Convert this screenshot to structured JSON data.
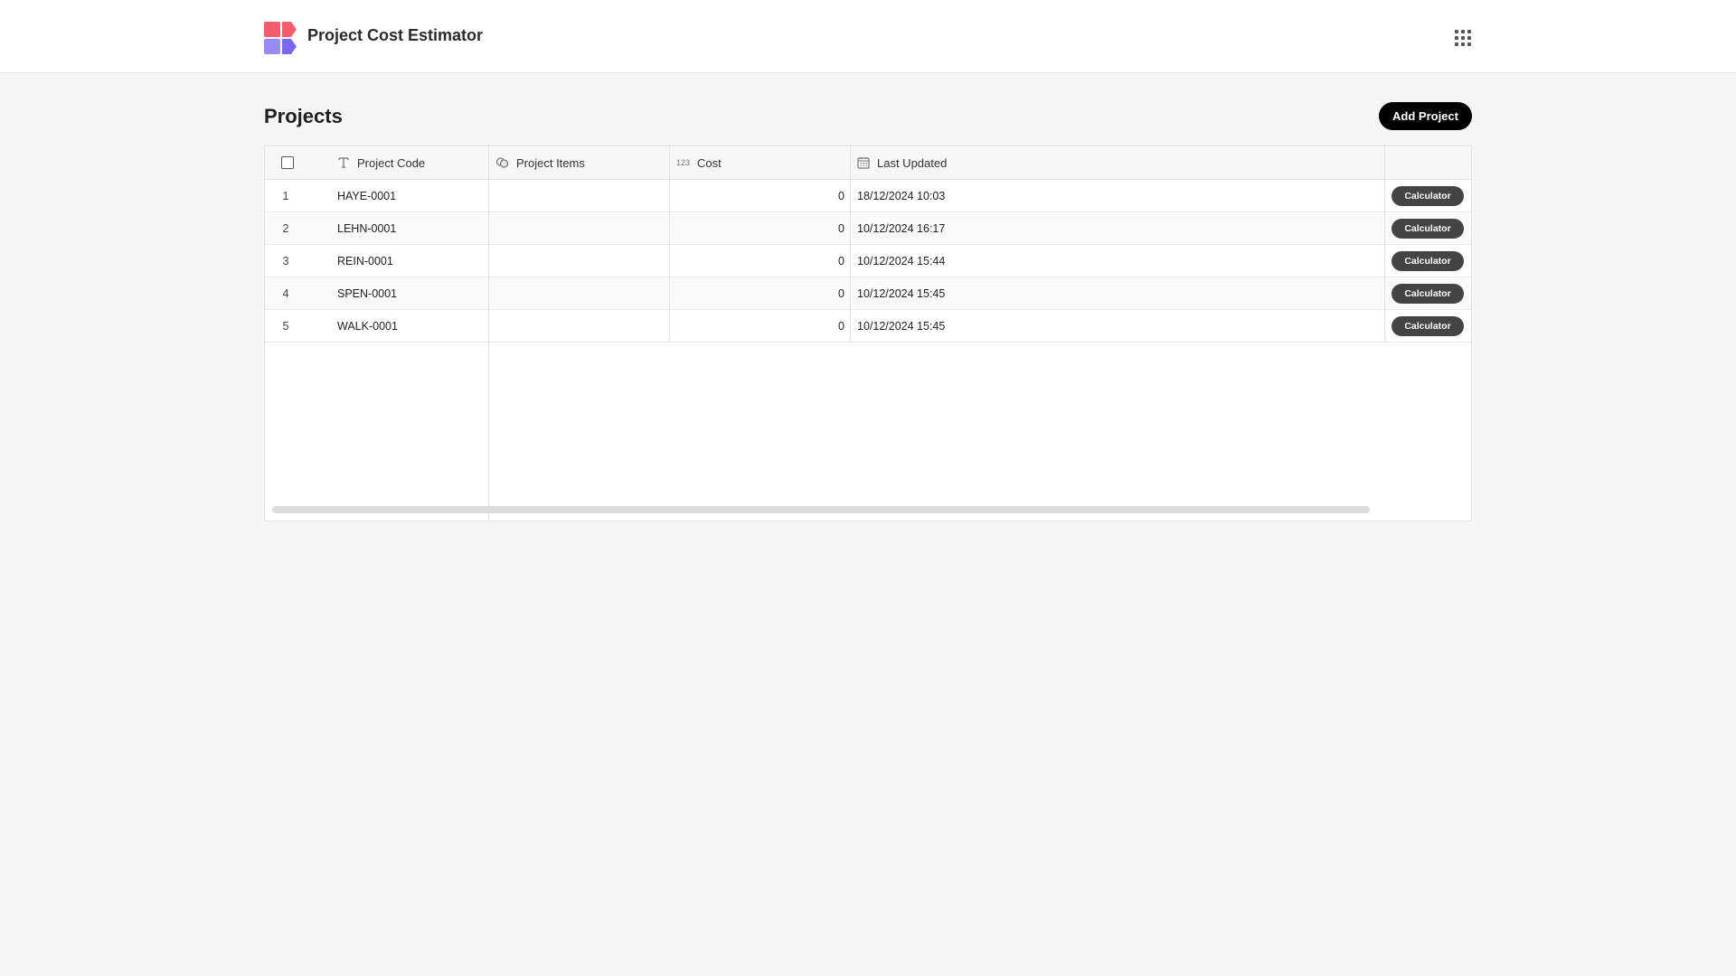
{
  "app": {
    "title": "Project Cost Estimator",
    "logo_colors": [
      "#f25c6e",
      "#8b7cf0"
    ]
  },
  "page": {
    "title": "Projects",
    "add_button_label": "Add Project"
  },
  "table": {
    "columns": [
      {
        "label": "Project Code",
        "icon": "text-type-icon"
      },
      {
        "label": "Project Items",
        "icon": "link-icon"
      },
      {
        "label": "Cost",
        "icon": "number-icon",
        "icon_text": "123"
      },
      {
        "label": "Last Updated",
        "icon": "calendar-icon"
      }
    ],
    "action_label": "Calculator",
    "rows": [
      {
        "index": "1",
        "code": "HAYE-0001",
        "items": "",
        "cost": "0",
        "updated": "18/12/2024 10:03"
      },
      {
        "index": "2",
        "code": "LEHN-0001",
        "items": "",
        "cost": "0",
        "updated": "10/12/2024 16:17"
      },
      {
        "index": "3",
        "code": "REIN-0001",
        "items": "",
        "cost": "0",
        "updated": "10/12/2024 15:44"
      },
      {
        "index": "4",
        "code": "SPEN-0001",
        "items": "",
        "cost": "0",
        "updated": "10/12/2024 15:45"
      },
      {
        "index": "5",
        "code": "WALK-0001",
        "items": "",
        "cost": "0",
        "updated": "10/12/2024 15:45"
      }
    ]
  }
}
